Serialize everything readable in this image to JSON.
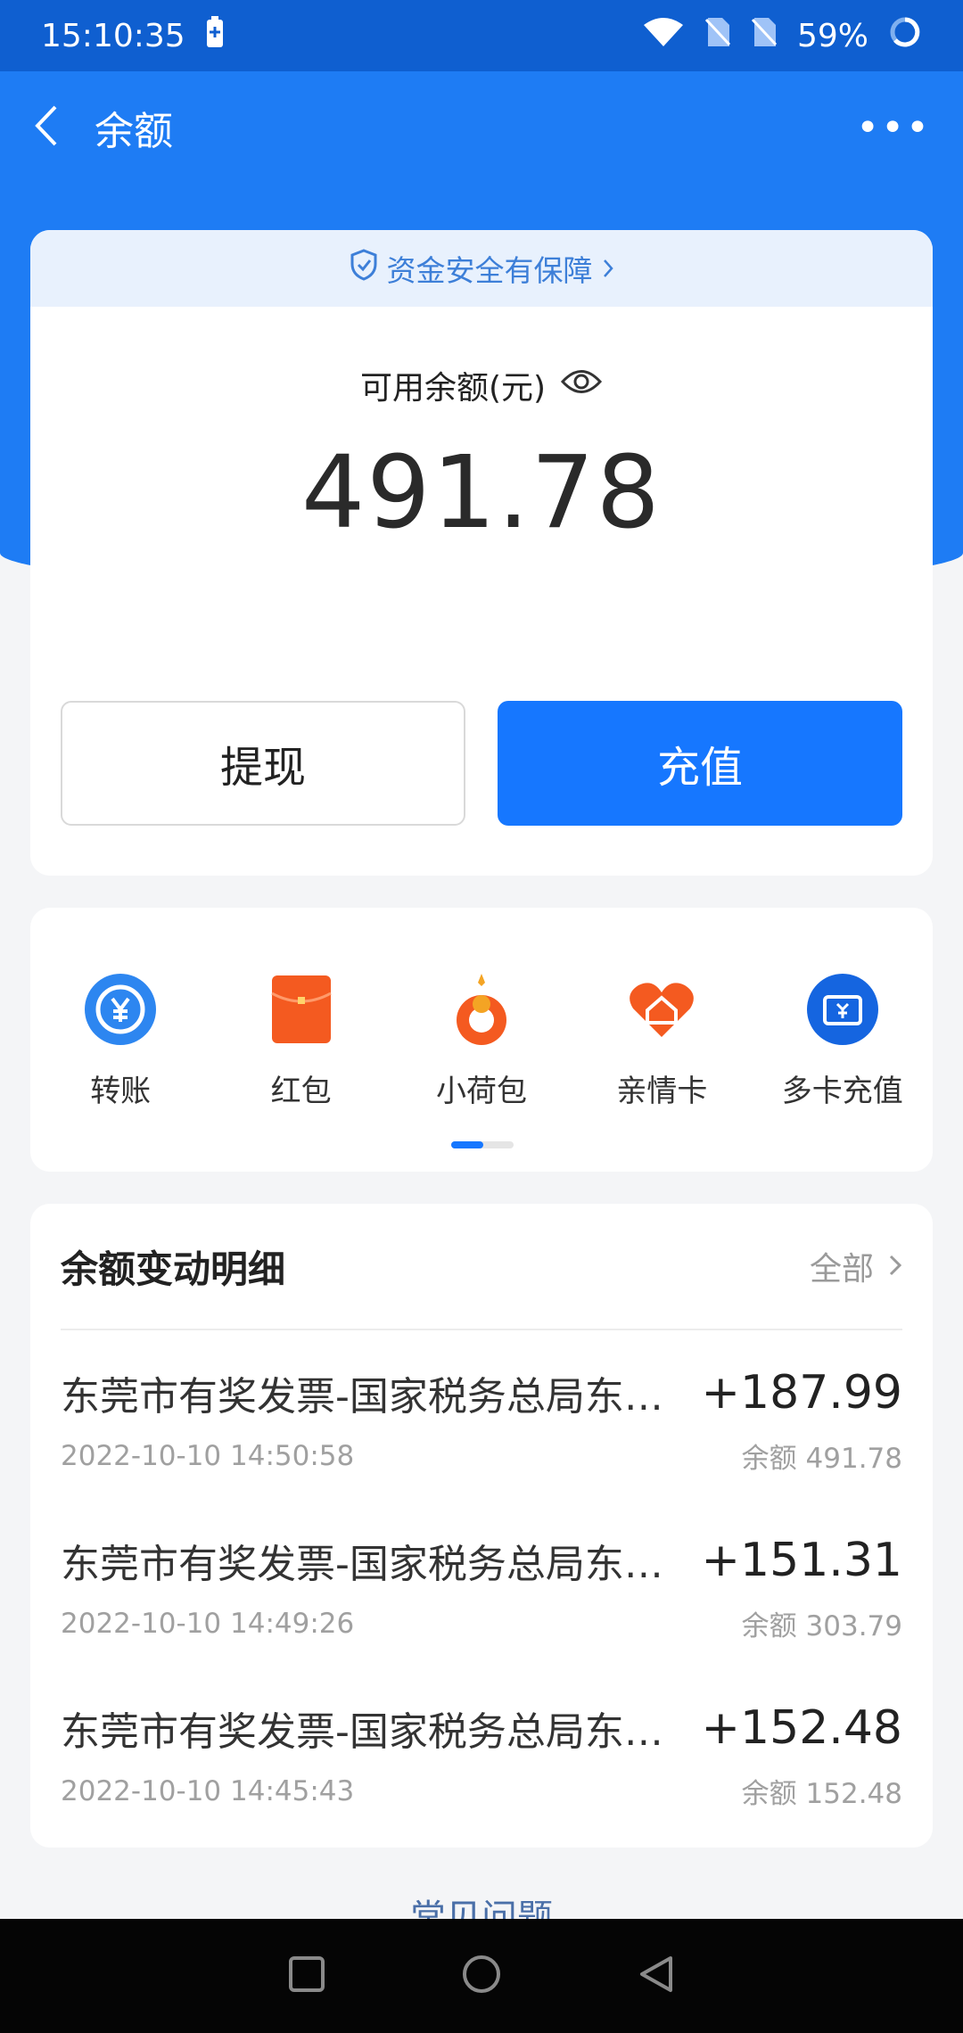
{
  "status_bar": {
    "time": "15:10:35",
    "battery": "59%"
  },
  "nav": {
    "title": "余额",
    "more": "•••"
  },
  "balance": {
    "safety_text": "资金安全有保障",
    "label": "可用余额(元)",
    "amount": "491.78",
    "withdraw_label": "提现",
    "recharge_label": "充值"
  },
  "shortcuts": [
    {
      "label": "转账",
      "icon": "transfer-icon"
    },
    {
      "label": "红包",
      "icon": "red-envelope-icon"
    },
    {
      "label": "小荷包",
      "icon": "small-purse-icon"
    },
    {
      "label": "亲情卡",
      "icon": "family-card-icon"
    },
    {
      "label": "多卡充值",
      "icon": "multi-card-recharge-icon"
    }
  ],
  "details": {
    "title": "余额变动明细",
    "all_label": "全部",
    "transactions": [
      {
        "name": "东莞市有奖发票-国家税务总局东…",
        "amount": "+187.99",
        "time": "2022-10-10 14:50:58",
        "balance": "余额 491.78"
      },
      {
        "name": "东莞市有奖发票-国家税务总局东…",
        "amount": "+151.31",
        "time": "2022-10-10 14:49:26",
        "balance": "余额 303.79"
      },
      {
        "name": "东莞市有奖发票-国家税务总局东…",
        "amount": "+152.48",
        "time": "2022-10-10 14:45:43",
        "balance": "余额 152.48"
      }
    ]
  },
  "faq_label": "常见问题",
  "colors": {
    "brand_blue": "#1677ff",
    "header_blue": "#1e7cf4",
    "status_blue": "#0f5fd0"
  }
}
